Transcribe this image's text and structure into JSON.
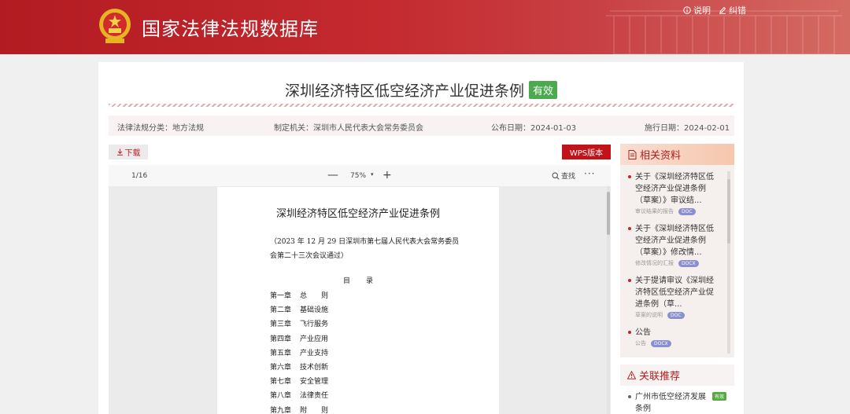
{
  "header": {
    "site_title": "国家法律法规数据库",
    "links": {
      "help": "说明",
      "feedback": "纠错"
    }
  },
  "document": {
    "title": "深圳经济特区低空经济产业促进条例",
    "status": "有效",
    "meta": {
      "category": "法律法规分类：地方法规",
      "authority": "制定机关：深圳市人民代表大会常务委员会",
      "publish_date": "公布日期：2024-01-03",
      "effective_date": "施行日期：2024-02-01"
    },
    "download_label": "下载",
    "wps_label": "WPS版本"
  },
  "viewer": {
    "page_indicator": "1/16",
    "zoom_out": "—",
    "zoom": "75%",
    "zoom_dropdown": "▾",
    "zoom_in": "+",
    "search_label": "查找",
    "more": "···",
    "page": {
      "title": "深圳经济特区低空经济产业促进条例",
      "subtitle": "（2023 年 12 月 29 日深圳市第七届人民代表大会常务委员会第二十三次会议通过）",
      "toc_title": "目录",
      "toc": [
        {
          "num": "第一章",
          "name": "总　　则"
        },
        {
          "num": "第二章",
          "name": "基础设施"
        },
        {
          "num": "第三章",
          "name": "飞行服务"
        },
        {
          "num": "第四章",
          "name": "产业应用"
        },
        {
          "num": "第五章",
          "name": "产业支持"
        },
        {
          "num": "第六章",
          "name": "技术创新"
        },
        {
          "num": "第七章",
          "name": "安全管理"
        },
        {
          "num": "第八章",
          "name": "法律责任"
        },
        {
          "num": "第九章",
          "name": "附　　则"
        }
      ]
    }
  },
  "related": {
    "title": "相关资料",
    "items": [
      {
        "text": "关于《深圳经济特区低空经济产业促进条例（草案）》审议结...",
        "sub": "审议结果的报告",
        "format": "DOC"
      },
      {
        "text": "关于《深圳经济特区低空经济产业促进条例（草案）》修改情...",
        "sub": "修改情况的汇报",
        "format": "DOCX"
      },
      {
        "text": "关于提请审议《深圳经济特区低空经济产业促进条例（草...",
        "sub": "草案的说明",
        "format": "DOC"
      },
      {
        "text": "公告",
        "sub": "公告",
        "format": "DOCX"
      }
    ]
  },
  "recommend": {
    "title": "关联推荐",
    "items": [
      {
        "text": "广州市低空经济发展条例",
        "badge": "有效"
      }
    ]
  },
  "colors": {
    "brand_red": "#c0141a",
    "status_green": "#4caa4e",
    "format_badge": "#8a8fd0"
  }
}
